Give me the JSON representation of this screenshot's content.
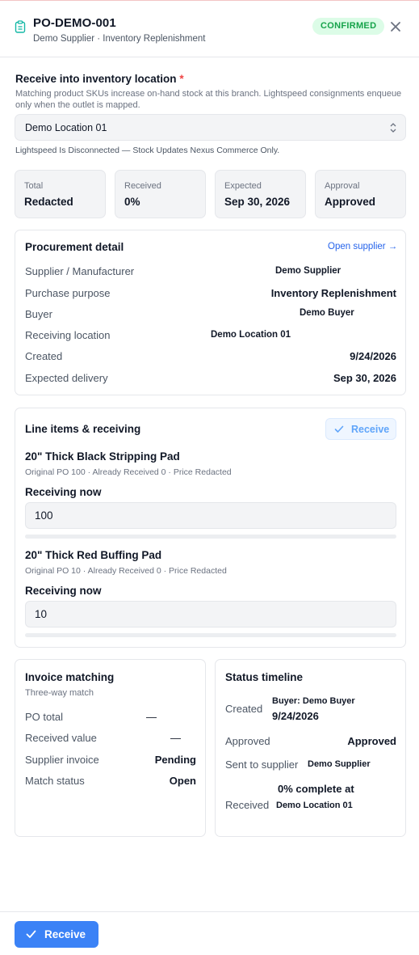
{
  "header": {
    "title": "PO-DEMO-001",
    "subtitle": "Demo Supplier · Inventory Replenishment",
    "status_badge": "CONFIRMED",
    "icons": {
      "document": "clipboard-icon",
      "close": "close-icon"
    },
    "colors": {
      "badge_bg": "#dcfce7",
      "badge_text": "#16a34a"
    }
  },
  "receive_location": {
    "label": "Receive into inventory location",
    "required_marker": "*",
    "help": "Matching product SKUs increase on-hand stock at this branch. Lightspeed consignments enqueue only when the outlet is mapped.",
    "selected": "Demo Location 01",
    "note": "Lightspeed Is Disconnected — Stock Updates Nexus Commerce Only."
  },
  "stats": [
    {
      "label": "Total",
      "value": "Redacted"
    },
    {
      "label": "Received",
      "value": "0%"
    },
    {
      "label": "Expected",
      "value": "Sep 30, 2026"
    },
    {
      "label": "Approval",
      "value": "Approved"
    }
  ],
  "procurement": {
    "title": "Procurement detail",
    "link": "Open supplier →",
    "rows": [
      {
        "label": "Supplier / Manufacturer",
        "value": "Demo Supplier"
      },
      {
        "label": "Purchase purpose",
        "value": "Inventory Replenishment"
      },
      {
        "label": "Buyer",
        "value": "Demo Buyer"
      },
      {
        "label": "Receiving location",
        "value": "Demo Location 01"
      },
      {
        "label": "Created",
        "value": "9/24/2026"
      },
      {
        "label": "Expected delivery",
        "value": "Sep 30, 2026"
      }
    ]
  },
  "line_items": {
    "title": "Line items & receiving",
    "receive_label": "Receive",
    "items": [
      {
        "name": "20\" Thick Black Stripping Pad",
        "meta": "Original PO 100 · Already Received 0 · Price Redacted",
        "receiving_label": "Receiving now",
        "receiving_value": "100",
        "progress": 0
      },
      {
        "name": "20\" Thick Red Buffing Pad",
        "meta": "Original PO 10 · Already Received 0 · Price Redacted",
        "receiving_label": "Receiving now",
        "receiving_value": "10",
        "progress": 0
      }
    ]
  },
  "invoice": {
    "title": "Invoice matching",
    "subtitle": "Three-way match",
    "rows": [
      {
        "label": "PO total",
        "value": "—"
      },
      {
        "label": "Received value",
        "value": "—"
      },
      {
        "label": "Supplier invoice",
        "value": "Pending"
      },
      {
        "label": "Match status",
        "value": "Open"
      }
    ]
  },
  "timeline": {
    "title": "Status timeline",
    "rows": [
      {
        "label": "Created",
        "value_line1": "Buyer: Demo Buyer",
        "value_line2": "9/24/2026"
      },
      {
        "label": "Approved",
        "value": "Approved"
      },
      {
        "label": "Sent to supplier",
        "value": "Demo Supplier"
      },
      {
        "label": "Received",
        "value_line1": "0% complete at",
        "value_line2": "Demo Location 01"
      }
    ]
  },
  "footer": {
    "receive_button": "Receive",
    "colors": {
      "primary": "#3b82f6"
    }
  }
}
